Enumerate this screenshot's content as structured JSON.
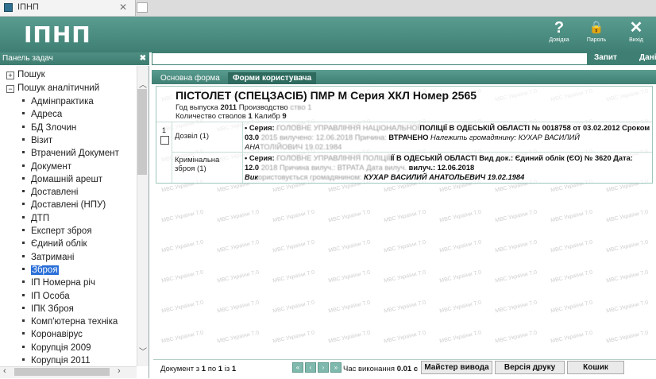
{
  "browser": {
    "tab_title": "ІПНП",
    "close_glyph": "✕"
  },
  "header": {
    "logo": "ІПНП",
    "buttons": [
      {
        "icon": "?",
        "label": "Довідка"
      },
      {
        "icon": "🔒",
        "label": "Пароль"
      },
      {
        "icon": "✕",
        "label": "Вихід"
      }
    ]
  },
  "left_panel": {
    "title": "Панель задач",
    "close_glyph": "✖",
    "root_items": [
      {
        "label": "Пошук",
        "toggle": "+"
      },
      {
        "label": "Пошук аналітичний",
        "toggle": "−"
      }
    ],
    "items": [
      "Адмінпрактика",
      "Адреса",
      "БД Злочин",
      "Візит",
      "Втрачений Документ",
      "Документ",
      "Домашній арешт",
      "Доставлені",
      "Доставлені (НПУ)",
      "ДТП",
      "Експерт зброя",
      "Єдиний облік",
      "Затримані",
      "Зброя",
      "ІП Номерна річ",
      "ІП Особа",
      "ІПК Зброя",
      "Комп'ютерна техніка",
      "Коронавірус",
      "Корупція 2009",
      "Корупція 2011"
    ],
    "selected": "Зброя"
  },
  "search": {
    "query": "",
    "run_label": "Запит",
    "data_label": "Дані"
  },
  "tabs": [
    {
      "label": "Основна форма",
      "active": false
    },
    {
      "label": "Форми користувача",
      "active": true
    }
  ],
  "record": {
    "title": "ПІСТОЛЕТ (СПЕЦЗАСІБ) ПМР М Серия ХКЛ Номер 2565",
    "year_label": "Год выпуска",
    "year_value": "2011",
    "producer_label": "Производство",
    "barrels_label": "Количество стволов",
    "barrels_value": "1",
    "caliber_label": "Калибр",
    "caliber_value": "9",
    "index": "1",
    "rows": [
      {
        "label": "Дозвіл (1)",
        "line1_a": "•  Серия:",
        "line1_blur": "ГОЛОВНЕ УПРАВЛІННЯ НАЦІОНАЛЬНОЇ",
        "line1_b": "ПОЛІЦІЇ В ОДЕСЬКІЙ ОБЛАСТІ № 0018758 от 03.02.2012 Сроком до",
        "line2_a": "03.0",
        "line2_blur": "2015 вилучено: 12.06.2018 Причина:",
        "line2_b": "ВТРАЧЕНО",
        "line2_c": "Належить громадянину: КУХАР ВАСИЛИЙ",
        "line3_a": "АНА",
        "line3_blur": "ТОЛІЙОВИЧ 19.02.1984"
      },
      {
        "label": "Кримінальна зброя (1)",
        "line1_a": "•  Серия:",
        "line1_blur": "ГОЛОВНЕ УПРАВЛІННЯ ПОЛІЦІЇ",
        "line1_b": "ІЇ В ОДЕСЬКІЙ ОБЛАСТІ Вид док.: Єдиний облік (ЄО) № 3620 Дата:",
        "line2_a": "12.0",
        "line2_blur": "2018 Причина вилуч.: ВТРАТА Дата вилуч.",
        "line2_b": "вилуч.: 12.06.2018",
        "line3_a": "Вик",
        "line3_blur": "ористовується громадянином:",
        "line3_b": "КУХАР ВАСИЛИЙ АНАТОЛЬЕВИЧ 19.02.1984"
      }
    ]
  },
  "watermark": "МВС України 7.0",
  "status": {
    "doc_prefix": "Документ з",
    "doc_from": "1",
    "doc_mid": "по",
    "doc_to": "1",
    "doc_of": "із",
    "doc_total": "1",
    "exec_label": "Час виконання",
    "exec_value": "0.01 с",
    "wizard_label": "Майстер вивода",
    "print_label": "Версія друку",
    "cart_label": "Кошик"
  }
}
